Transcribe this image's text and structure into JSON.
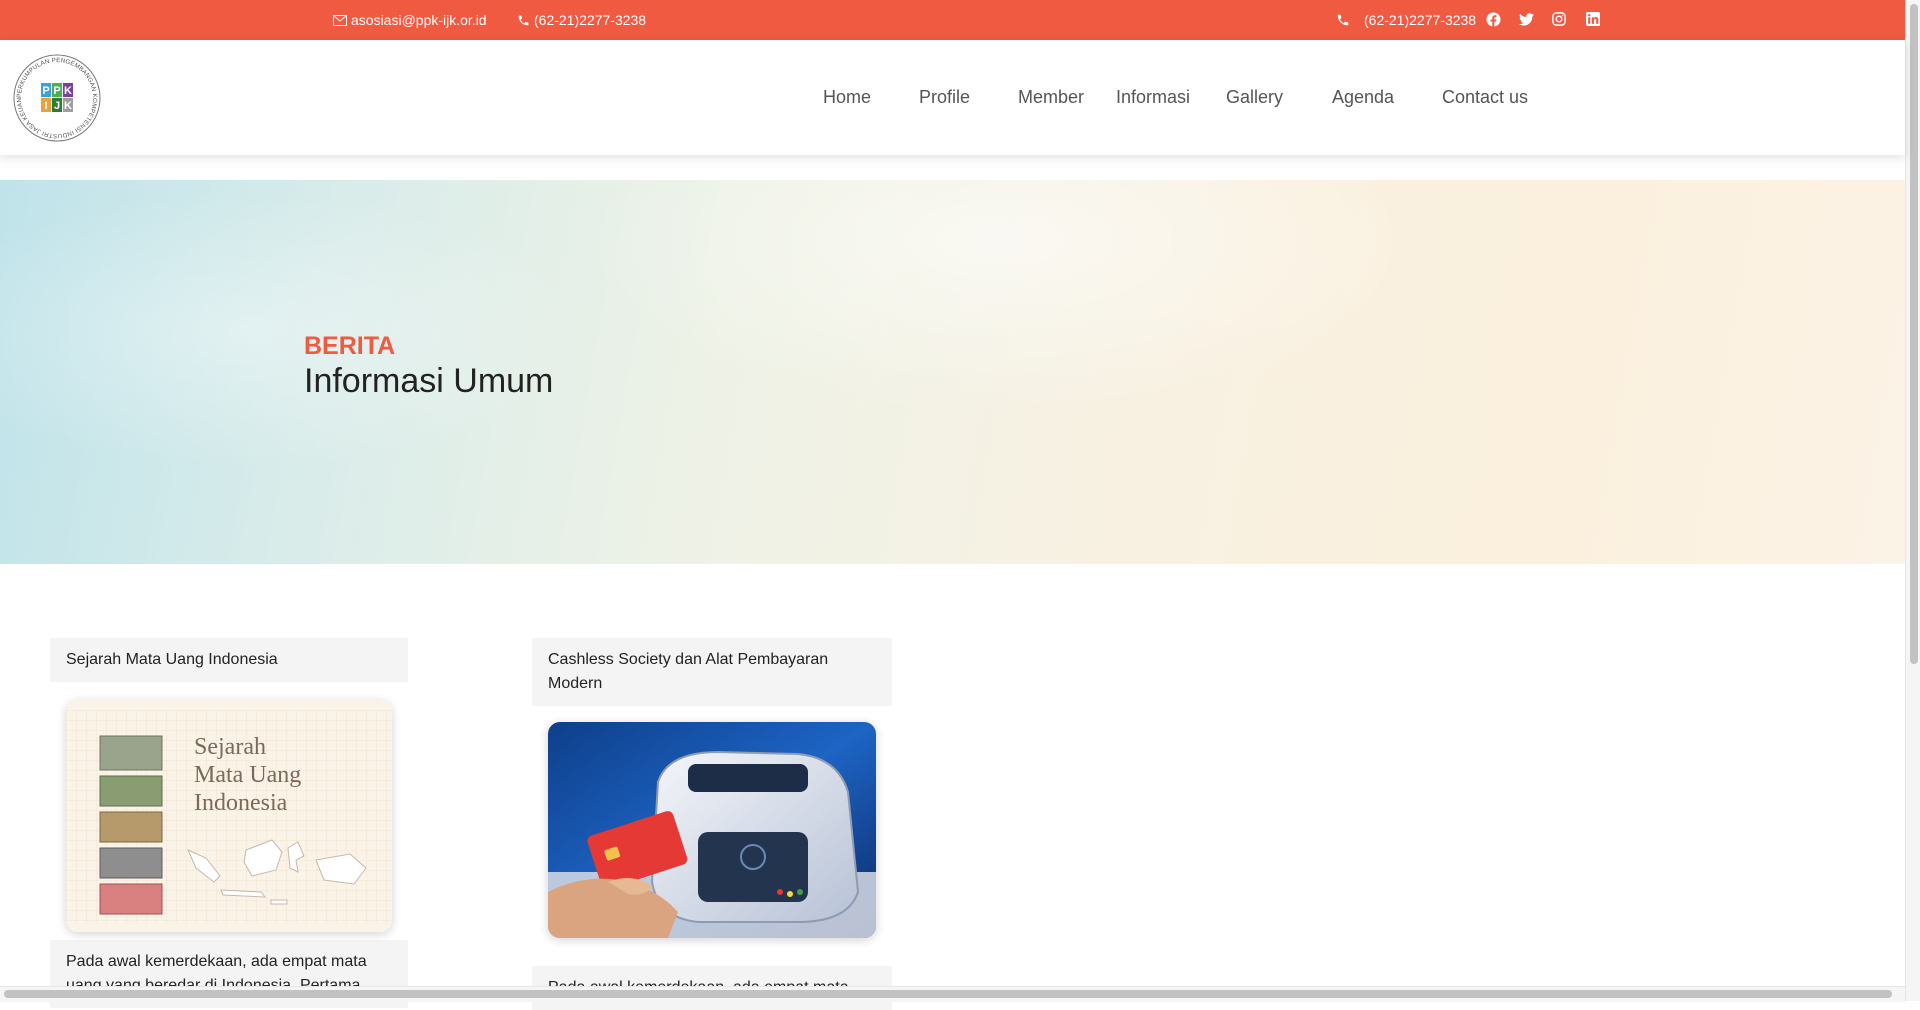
{
  "topbar": {
    "email": "asosiasi@ppk-ijk.or.id",
    "phone_left": "(62-21)2277-3238",
    "phone_right": "(62-21)2277-3238",
    "social_icons": [
      "facebook-icon",
      "twitter-icon",
      "instagram-icon",
      "linkedin-icon"
    ],
    "background_color": "#f05a40"
  },
  "logo": {
    "letters": [
      "P",
      "P",
      "K",
      "I",
      "J",
      "K"
    ],
    "ring_text": "PERKUMPULAN PENGEMBANGAN KOMPETENSI INDUSTRI JASA KEUANGAN"
  },
  "nav": {
    "items": [
      "Home",
      "Profile",
      "Member",
      "Informasi",
      "Gallery",
      "Agenda",
      "Contact us"
    ]
  },
  "hero": {
    "kicker": "BERITA",
    "title": "Informasi Umum"
  },
  "cards": [
    {
      "title": "Sejarah Mata Uang Indonesia",
      "image_text": [
        "Sejarah",
        "Mata Uang",
        "Indonesia"
      ],
      "excerpt": "Pada awal kemerdekaan, ada empat mata uang yang beredar di Indonesia. Pertama,"
    },
    {
      "title": "Cashless Society dan Alat Pembayaran Modern",
      "excerpt": "Pada awal kemerdekaan, ada empat mata"
    }
  ],
  "colors": {
    "accent": "#f05a40"
  }
}
